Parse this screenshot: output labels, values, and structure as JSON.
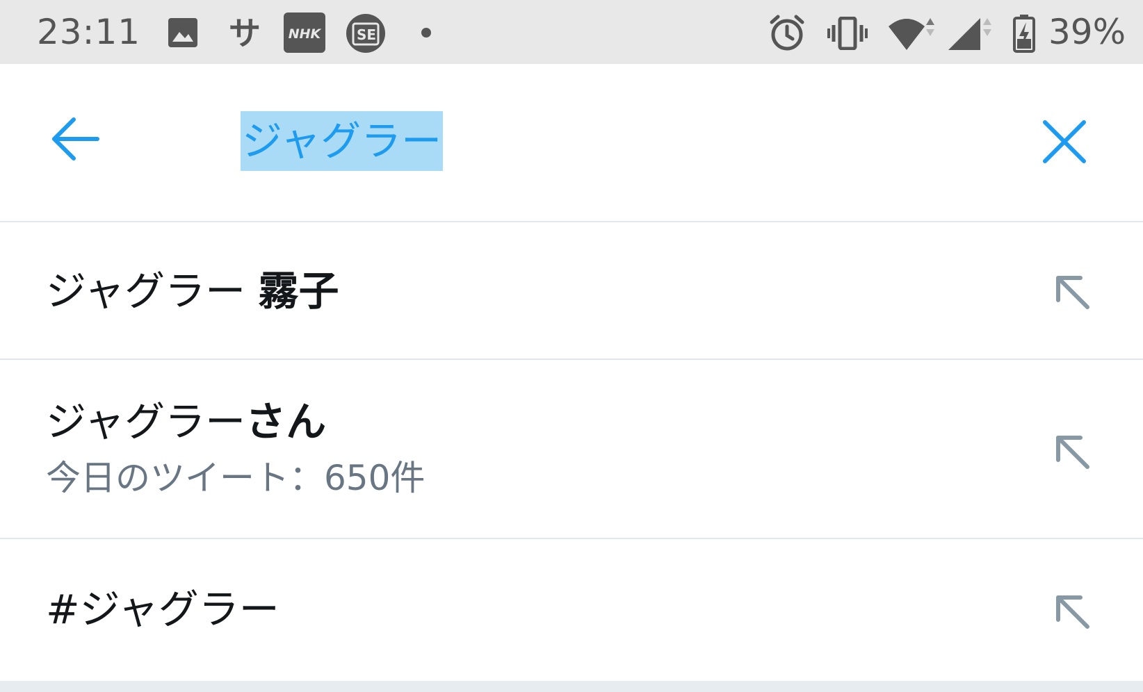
{
  "status_bar": {
    "time": "23:11",
    "notification_icons": [
      "image-icon",
      "sa-app-icon",
      "nhk-icon",
      "se-app-icon",
      "more-dot-icon"
    ],
    "nhk_label": "NHK",
    "se_label": "SE",
    "sa_label": "サ",
    "system_icons": [
      "alarm-icon",
      "vibrate-icon",
      "wifi-icon",
      "signal-icon",
      "battery-charging-icon"
    ],
    "battery_percent": "39%"
  },
  "search": {
    "back_icon": "arrow-left-icon",
    "query": "ジャグラー",
    "clear_icon": "close-icon",
    "accent_color": "#1d9bf0",
    "selection_color": "#a9dbf7"
  },
  "suggestions": [
    {
      "prefix": "ジャグラー ",
      "bold": "霧子",
      "subtitle": "",
      "fill_icon": "arrow-up-left-icon"
    },
    {
      "prefix": "ジャグラー",
      "bold": "さん",
      "subtitle": "今日のツイート：650件",
      "fill_icon": "arrow-up-left-icon"
    },
    {
      "prefix": "#ジャグラー",
      "bold": "",
      "subtitle": "",
      "fill_icon": "arrow-up-left-icon"
    }
  ]
}
